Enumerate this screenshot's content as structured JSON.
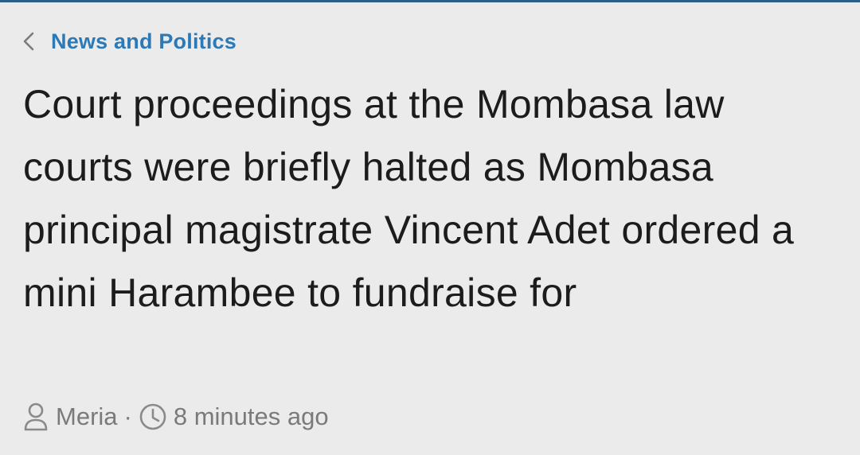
{
  "breadcrumb": {
    "back_icon": "chevron-left-icon",
    "category": "News and Politics"
  },
  "article": {
    "headline": "Court proceedings at the Mombasa law courts were briefly halted as Mombasa principal magistrate Vincent Adet ordered a mini Harambee to fundraise for"
  },
  "meta": {
    "author_icon": "person-icon",
    "author": "Meria",
    "separator": "·",
    "time_icon": "clock-icon",
    "time": "8 minutes ago"
  },
  "colors": {
    "background": "#ebebeb",
    "accent": "#2d79b5",
    "headline_text": "#1c1c1c",
    "meta_text": "#7a7a7a",
    "top_rule": "#2f5f86"
  }
}
